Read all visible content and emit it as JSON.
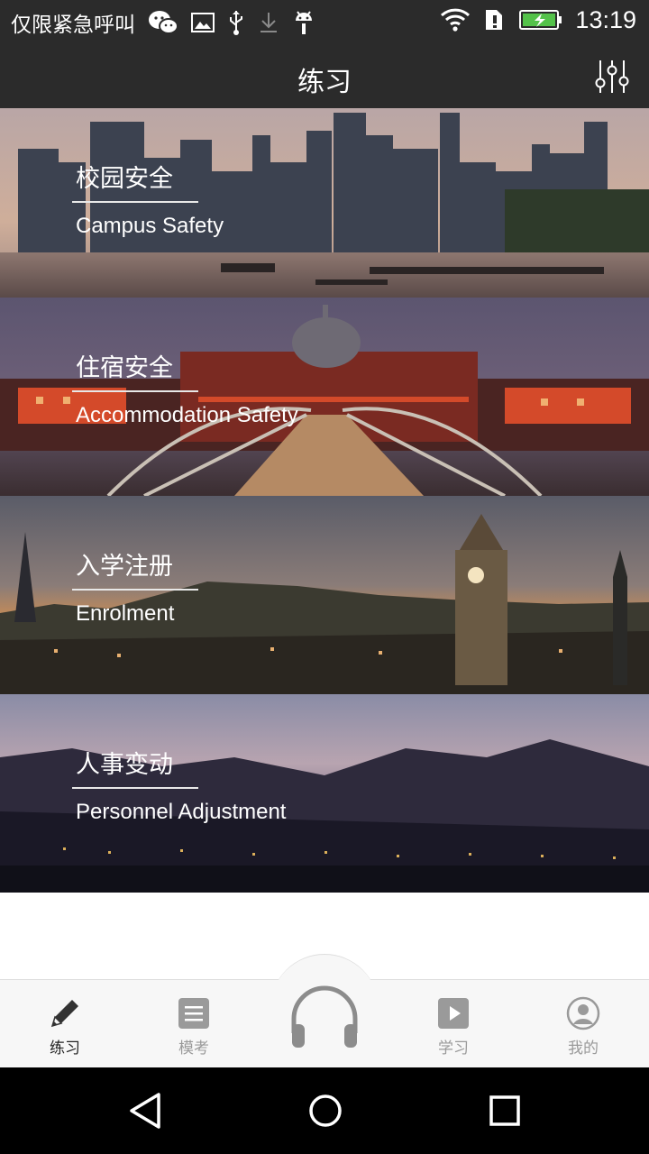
{
  "status_bar": {
    "carrier": "仅限紧急呼叫",
    "time": "13:19",
    "icons": [
      "wechat-icon",
      "image-icon",
      "usb-icon",
      "download-icon",
      "android-icon",
      "wifi-icon",
      "sim-alert-icon",
      "battery-charging-icon"
    ]
  },
  "header": {
    "title": "练习",
    "filter_icon": "sliders-icon"
  },
  "categories": [
    {
      "title": "校园安全",
      "subtitle": "Campus Safety"
    },
    {
      "title": "住宿安全",
      "subtitle": "Accommodation Safety"
    },
    {
      "title": "入学注册",
      "subtitle": "Enrolment"
    },
    {
      "title": "人事变动",
      "subtitle": "Personnel Adjustment"
    }
  ],
  "bottom_nav": {
    "items": [
      {
        "label": "练习",
        "icon": "pencil-icon",
        "active": true
      },
      {
        "label": "模考",
        "icon": "list-icon",
        "active": false
      },
      {
        "label": "",
        "icon": "headphones-icon",
        "active": false
      },
      {
        "label": "学习",
        "icon": "play-icon",
        "active": false
      },
      {
        "label": "我的",
        "icon": "user-icon",
        "active": false
      }
    ]
  },
  "colors": {
    "bar": "#2b2b2b",
    "nav_bg": "#f7f7f7",
    "nav_inactive": "#9a9a9a",
    "nav_active": "#222222"
  }
}
